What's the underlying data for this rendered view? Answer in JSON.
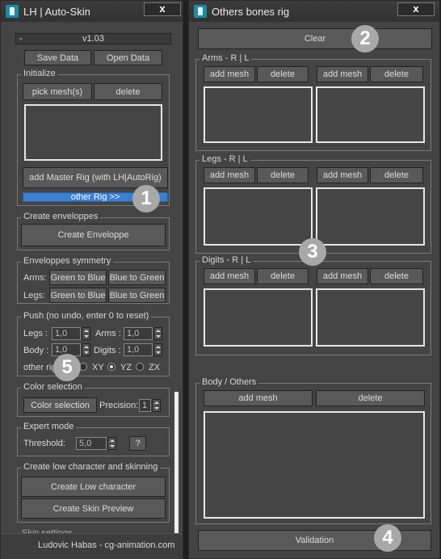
{
  "left_window": {
    "title": "LH | Auto-Skin",
    "close": "x",
    "rollout_toggle": "-",
    "version": "v1.03",
    "save_data": "Save Data",
    "open_data": "Open Data",
    "initialize": {
      "label": "Initialize",
      "pick_mesh": "pick mesh(s)",
      "delete": "delete",
      "add_master_rig": "add Master Rig (with LH|AutoRig)",
      "other_rig": "other Rig >>"
    },
    "create_envelopes": {
      "label": "Create enveloppes",
      "button": "Create Enveloppe"
    },
    "symmetry": {
      "label": "Enveloppes symmetry",
      "arms": "Arms:",
      "legs": "Legs:",
      "green_to_blue": "Green to Blue",
      "blue_to_green": "Blue to Green"
    },
    "push": {
      "label": "Push (no undo, enter 0 to reset)",
      "legs": "Legs :",
      "arms": "Arms :",
      "body": "Body :",
      "digits": "Digits :",
      "legs_value": "1,0",
      "arms_value": "1,0",
      "body_value": "1,0",
      "digits_value": "1,0",
      "other_rig": "other rig",
      "xy": "XY",
      "yz": "YZ",
      "zx": "ZX",
      "selected_axis": "YZ"
    },
    "color_selection": {
      "label": "Color selection",
      "button": "Color selection",
      "precision_label": "Precision:",
      "precision_value": "1"
    },
    "expert": {
      "label": "Expert mode",
      "threshold_label": "Threshold:",
      "threshold_value": "5,0",
      "help": "?"
    },
    "low_character": {
      "label": "Create low character and skinning",
      "create_low": "Create Low character",
      "skin_preview": "Create Skin Preview"
    },
    "skin_settings": "Skin settings",
    "footer": "Ludovic Habas - cg-animation.com"
  },
  "right_window": {
    "title": "Others bones rig",
    "close": "x",
    "clear": "Clear",
    "arms": "Arms - R | L",
    "legs": "Legs - R | L",
    "digits": "Digits - R | L",
    "body": "Body / Others",
    "add_mesh": "add mesh",
    "delete": "delete",
    "validation": "Validation"
  },
  "callouts": [
    "1",
    "2",
    "3",
    "4",
    "5"
  ],
  "colors": {
    "accent_blue": "#3a7fd4",
    "panel": "#444444",
    "badge": "#a8a8a8"
  }
}
